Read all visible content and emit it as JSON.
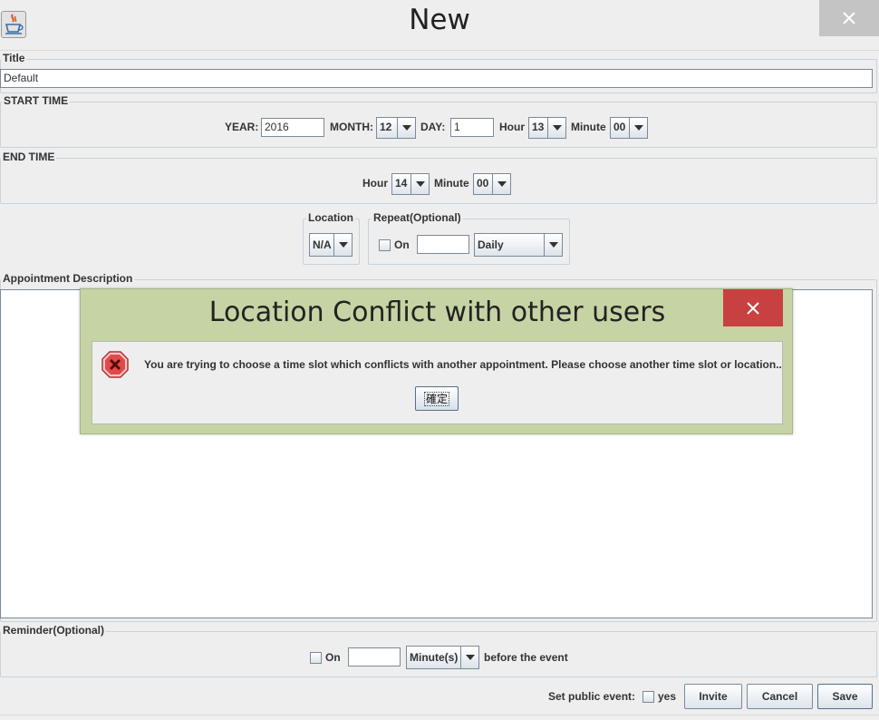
{
  "window": {
    "title": "New",
    "app_icon": "java-cup-icon",
    "close_icon": "close-icon"
  },
  "title_section": {
    "label": "Title",
    "value": "Default"
  },
  "start_time": {
    "label": "START TIME",
    "year_label": "YEAR:",
    "year_value": "2016",
    "month_label": "MONTH:",
    "month_value": "12",
    "day_label": "DAY:",
    "day_value": "1",
    "hour_label": "Hour",
    "hour_value": "13",
    "minute_label": "Minute",
    "minute_value": "00"
  },
  "end_time": {
    "label": "END TIME",
    "hour_label": "Hour",
    "hour_value": "14",
    "minute_label": "Minute",
    "minute_value": "00"
  },
  "location": {
    "label": "Location",
    "value": "N/A"
  },
  "repeat": {
    "label": "Repeat(Optional)",
    "on_label": "On",
    "interval_value": "",
    "frequency_value": "Daily"
  },
  "description": {
    "label": "Appointment Description",
    "value": ""
  },
  "reminder": {
    "label": "Reminder(Optional)",
    "on_label": "On",
    "amount_value": "",
    "unit_value": "Minute(s)",
    "suffix": "before the event"
  },
  "footer": {
    "public_label": "Set public event:",
    "yes_label": "yes",
    "invite_label": "Invite",
    "cancel_label": "Cancel",
    "save_label": "Save"
  },
  "dialog": {
    "title": "Location Conflict with other users",
    "message": "You are trying to choose a time slot which conflicts with another appointment. Please choose another time slot or location..",
    "ok_label": "確定",
    "icon": "error-icon",
    "title_bar_color": "#c6d3a4",
    "close_color": "#c94040"
  },
  "colors": {
    "background": "#eeeeee",
    "border": "#7a8a99",
    "dialog_close": "#c94040"
  }
}
